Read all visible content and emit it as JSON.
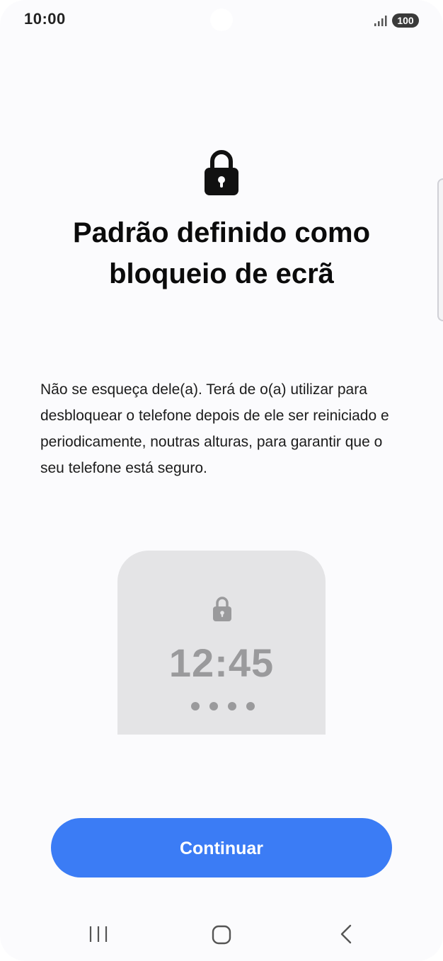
{
  "status_bar": {
    "time": "10:00",
    "battery": "100",
    "signal_icon": "signal-bars-icon"
  },
  "header": {
    "icon": "lock-icon",
    "title_line1": "Padrão definido como",
    "title_line2": "bloqueio de ecrã"
  },
  "description": "Não se esqueça dele(a). Terá de o(a) utilizar para desbloquear o telefone depois de ele ser reiniciado e periodicamente, noutras alturas, para garantir que o seu telefone está seguro.",
  "preview": {
    "icon": "lock-icon",
    "clock": "12:45",
    "pin_dots": 4
  },
  "continue_button": {
    "label": "Continuar",
    "color": "#3b7cf5"
  },
  "nav_bar": {
    "recents_icon": "recents-icon",
    "home_icon": "home-icon",
    "back_icon": "back-icon"
  }
}
